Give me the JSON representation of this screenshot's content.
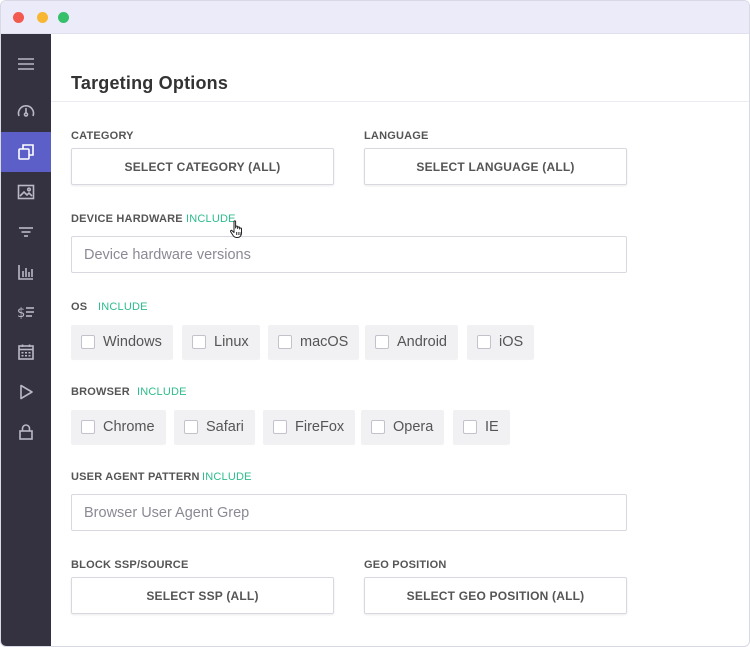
{
  "window": {
    "controls": [
      "close",
      "minimize",
      "maximize"
    ]
  },
  "sidebar": {
    "items": [
      {
        "icon": "menu-icon"
      },
      {
        "icon": "dashboard-gauge-icon"
      },
      {
        "icon": "campaigns-copy-icon",
        "active": true
      },
      {
        "icon": "image-icon"
      },
      {
        "icon": "filter-icon"
      },
      {
        "icon": "bar-chart-icon"
      },
      {
        "icon": "pricing-icon"
      },
      {
        "icon": "calendar-icon"
      },
      {
        "icon": "play-icon"
      },
      {
        "icon": "lock-icon"
      }
    ],
    "active_color": "#5b5fc7",
    "bg_color": "#343240"
  },
  "page": {
    "title": "Targeting Options"
  },
  "category": {
    "label": "CATEGORY",
    "button": "SELECT CATEGORY (ALL)"
  },
  "language": {
    "label": "LANGUAGE",
    "button": "SELECT LANGUAGE (ALL)"
  },
  "device_hardware": {
    "label": "DEVICE HARDWARE",
    "include": "INCLUDE",
    "placeholder": "Device hardware versions"
  },
  "os": {
    "label": "OS",
    "include": "INCLUDE",
    "options": [
      "Windows",
      "Linux",
      "macOS",
      "Android",
      "iOS"
    ]
  },
  "browser": {
    "label": "BROWSER",
    "include": "INCLUDE",
    "options": [
      "Chrome",
      "Safari",
      "FireFox",
      "Opera",
      "IE"
    ]
  },
  "user_agent": {
    "label": "USER AGENT PATTERN",
    "include": "INCLUDE",
    "placeholder": "Browser User Agent Grep"
  },
  "block_ssp": {
    "label": "BLOCK SSP/SOURCE",
    "button": "SELECT SSP (ALL)"
  },
  "geo_position": {
    "label": "GEO POSITION",
    "button": "SELECT GEO POSITION (ALL)"
  },
  "colors": {
    "include": "#2dbd8a",
    "titlebar": "#ebebfa"
  }
}
